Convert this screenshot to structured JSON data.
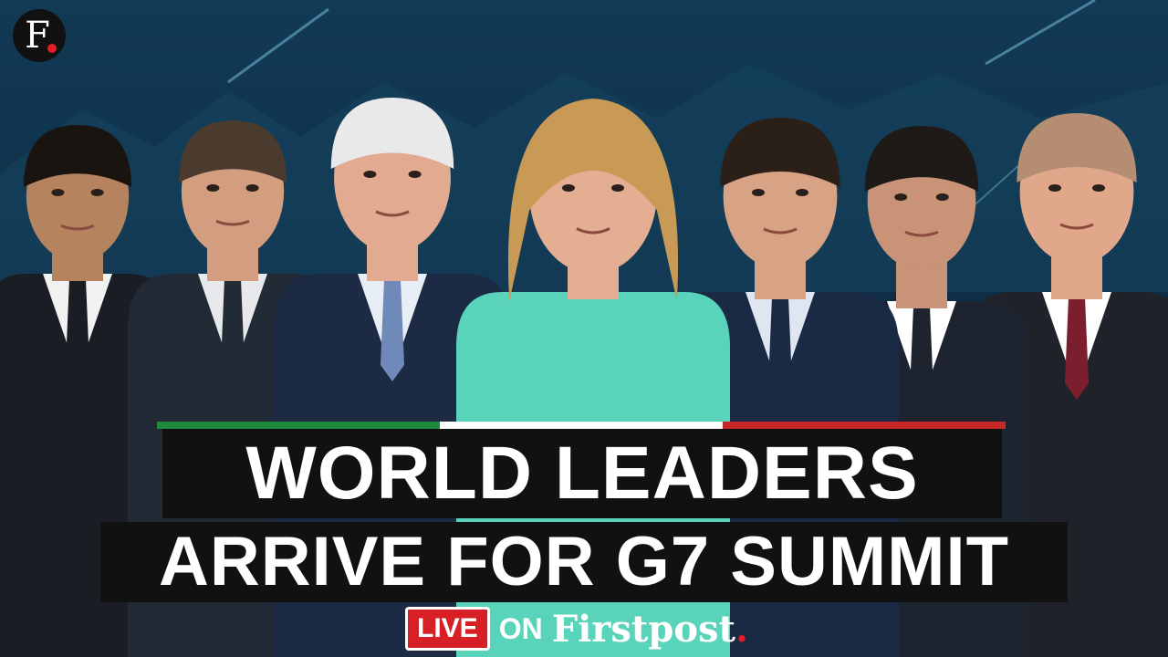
{
  "logo": {
    "letter": "F.",
    "letter_main": "F"
  },
  "headline": {
    "line1": "WORLD LEADERS",
    "line2": "ARRIVE FOR G7 SUMMIT"
  },
  "footer": {
    "live": "LIVE",
    "on": "ON",
    "brand": "Firstpost",
    "brand_dot": "."
  },
  "colors": {
    "background": "#0d2a3d",
    "accent_red": "#e11d2a",
    "flag_green": "#1f8a3b",
    "flag_white": "#ffffff",
    "flag_red": "#c62828",
    "headline_bg": "#111111"
  },
  "people": [
    {
      "name": "leader-1",
      "suit": "#1a1d24",
      "tie": "#1a1d24",
      "shirt": "#f1f1f1",
      "skin": "#b5835d",
      "hair": "#1a1410"
    },
    {
      "name": "leader-2",
      "suit": "#222a36",
      "tie": "#222a36",
      "shirt": "#e6e8ec",
      "skin": "#d39d80",
      "hair": "#4a3b2e"
    },
    {
      "name": "leader-3",
      "suit": "#1d2a44",
      "tie": "#6f8ab8",
      "shirt": "#e8eef6",
      "skin": "#e2aa91",
      "hair": "#e9e9e9"
    },
    {
      "name": "leader-4",
      "suit": "#59d3b9",
      "tie": "#59d3b9",
      "shirt": "#59d3b9",
      "skin": "#e4ae93",
      "hair": "#c99a55"
    },
    {
      "name": "leader-5",
      "suit": "#1b2a44",
      "tie": "#1b2a44",
      "shirt": "#dfe6f2",
      "skin": "#d8a285",
      "hair": "#2a2018"
    },
    {
      "name": "leader-6",
      "suit": "#1d2430",
      "tie": "#1d2430",
      "shirt": "#ffffff",
      "skin": "#c99377",
      "hair": "#1d1a18"
    },
    {
      "name": "leader-7",
      "suit": "#1f2329",
      "tie": "#7b1f2e",
      "shirt": "#ffffff",
      "skin": "#e0a78a",
      "hair": "#b58d72"
    }
  ]
}
